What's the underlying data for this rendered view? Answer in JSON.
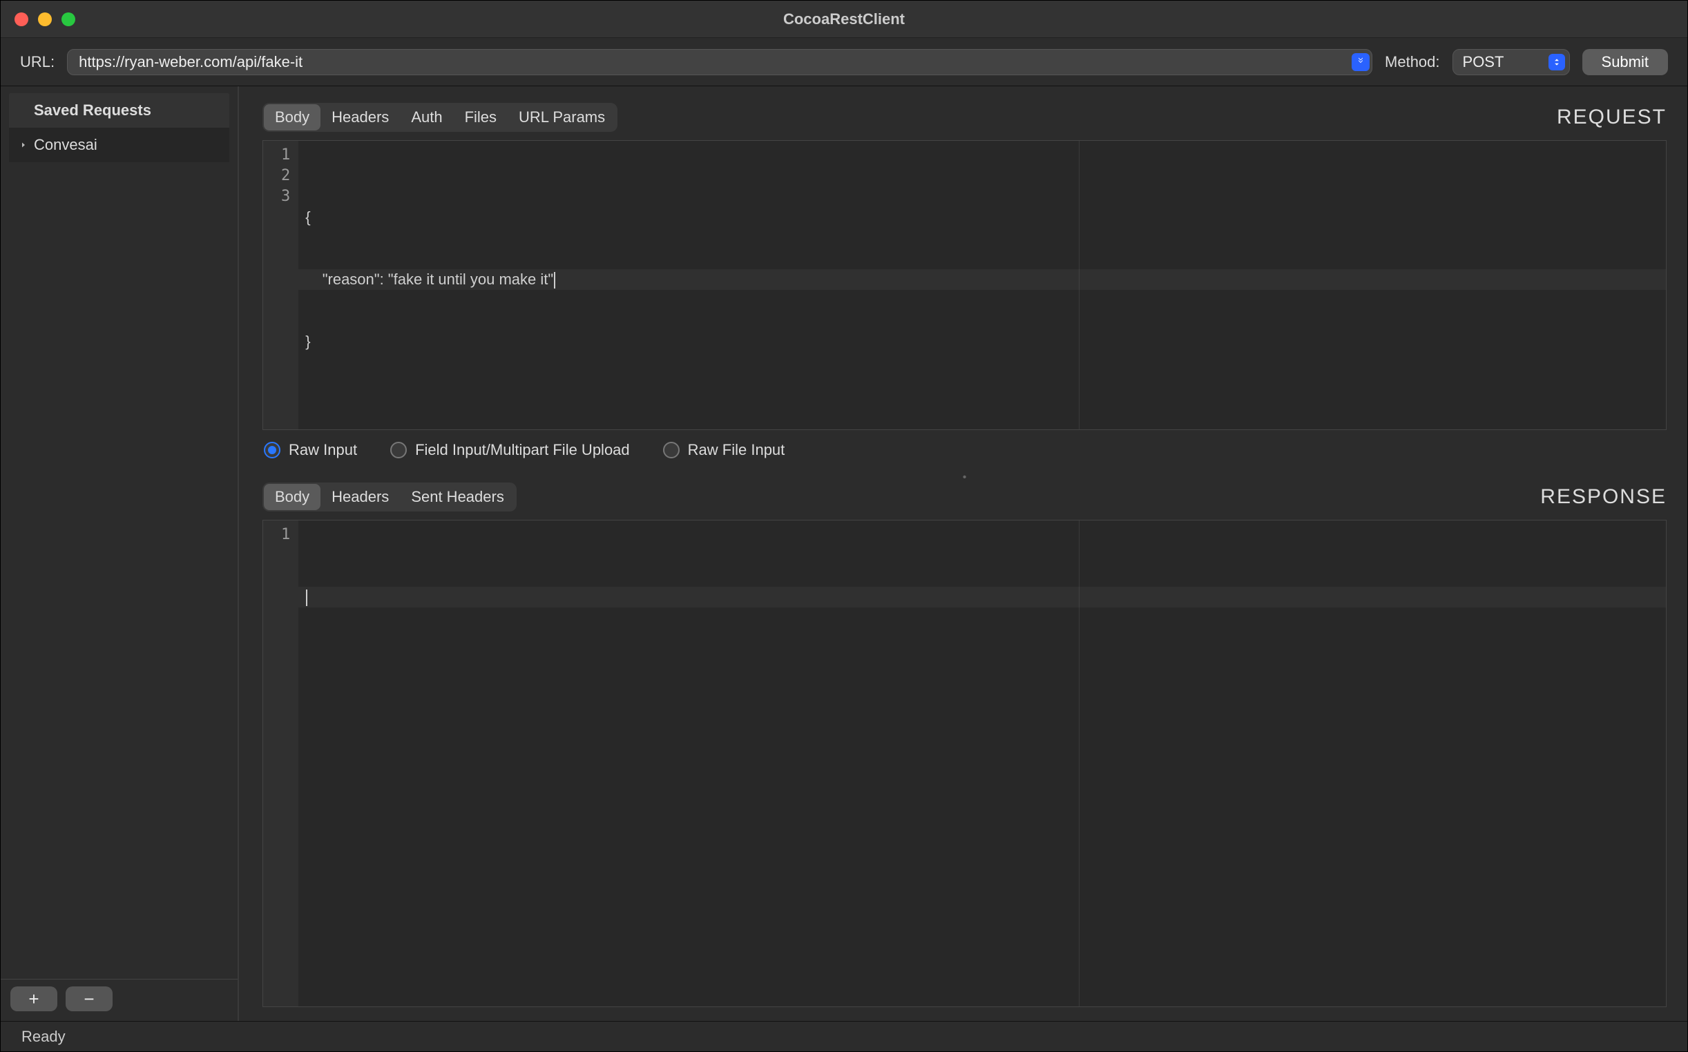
{
  "window": {
    "title": "CocoaRestClient"
  },
  "toolbar": {
    "url_label": "URL:",
    "url_value": "https://ryan-weber.com/api/fake-it",
    "method_label": "Method:",
    "method_value": "POST",
    "submit_label": "Submit"
  },
  "sidebar": {
    "header": "Saved Requests",
    "items": [
      {
        "label": "Convesai"
      }
    ],
    "add_label": "+",
    "remove_label": "−"
  },
  "request": {
    "section_title": "REQUEST",
    "tabs": [
      "Body",
      "Headers",
      "Auth",
      "Files",
      "URL Params"
    ],
    "active_tab": "Body",
    "gutter": "1\n2\n3",
    "code_lines": [
      "{",
      "    \"reason\": \"fake it until you make it\"",
      "}"
    ],
    "input_modes": [
      {
        "label": "Raw Input",
        "checked": true
      },
      {
        "label": "Field Input/Multipart File Upload",
        "checked": false
      },
      {
        "label": "Raw File Input",
        "checked": false
      }
    ]
  },
  "response": {
    "section_title": "RESPONSE",
    "tabs": [
      "Body",
      "Headers",
      "Sent Headers"
    ],
    "active_tab": "Body",
    "gutter": "1",
    "code_lines": [
      ""
    ]
  },
  "status": {
    "text": "Ready"
  }
}
